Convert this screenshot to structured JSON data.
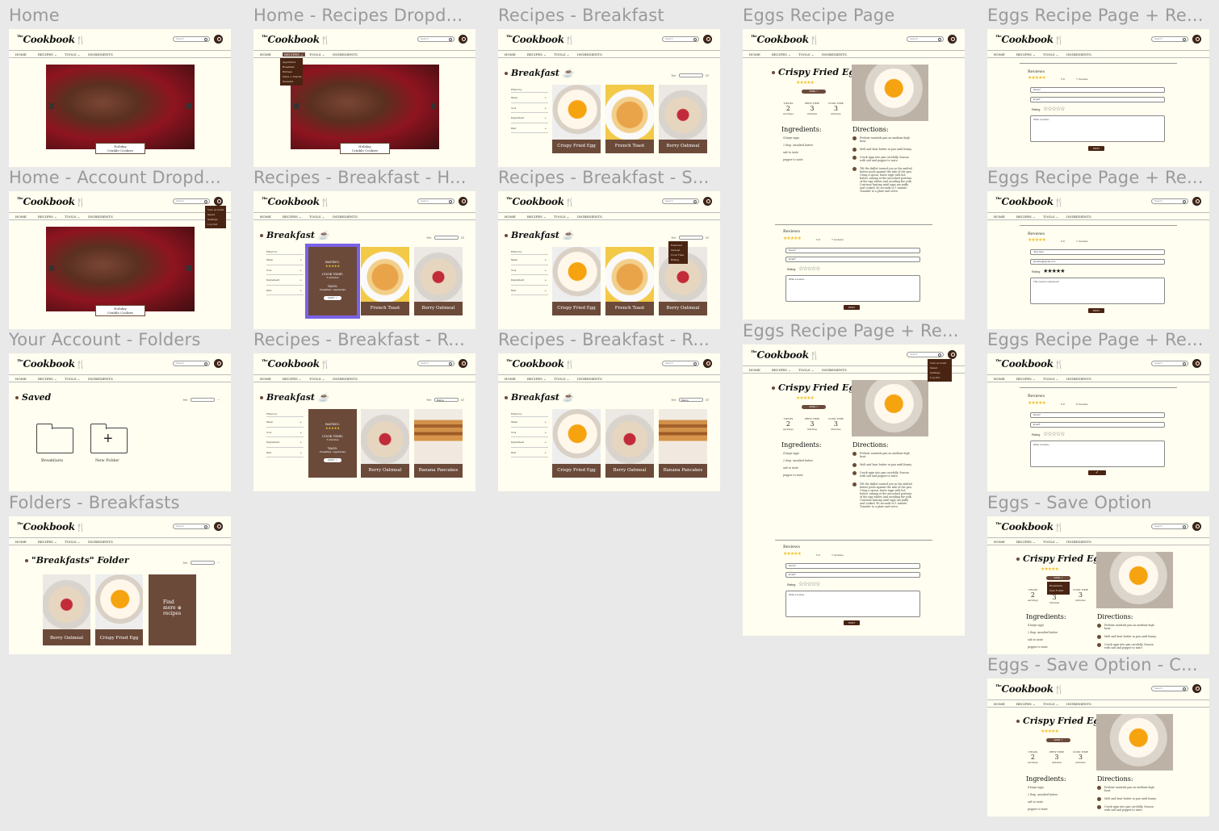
{
  "app": {
    "logo_the": "The",
    "logo_name": "Cookbook",
    "search_placeholder": "Search",
    "nav": {
      "home": "HOME",
      "recipes": "RECIPES ⌄",
      "tools": "TOOLS ⌄",
      "ingredients": "INGREDIENTS"
    }
  },
  "frames": {
    "home": "Home",
    "home_recipes": "Home - Recipes Dropd...",
    "breakfast": "Recipes - Breakfast",
    "eggs": "Eggs Recipe Page",
    "eggs_re1": "Eggs Recipe Page + Re...",
    "home_account": "Home - Account Dropd...",
    "breakfast_h": "Recipes - Breakfast - H...",
    "breakfast_s": "Recipes - Breakfast - S...",
    "eggs_re2": "Eggs Recipe Page + Re...",
    "folders": "Your Account - Folders",
    "breakfast_r1": "Recipes - Breakfast - R...",
    "breakfast_r2": "Recipes - Breakfast - R...",
    "eggs_re3": "Eggs Recipe Page + Re...",
    "eggs_re4": "Eggs Recipe Page + Re...",
    "folders_breakfasts": "Folders - Breakfasts",
    "eggs_save": "Eggs - Save Option",
    "eggs_save_c": "Eggs - Save Option - C..."
  },
  "hero": {
    "caption": "Holiday\nCrinkle Cookies"
  },
  "recipes_dropdown": [
    "Appetizers",
    "Breakfast",
    "Entrees",
    "Sides + Snacks",
    "Desserts"
  ],
  "account_dropdown": [
    "Your Account",
    "Saved",
    "Settings",
    "Log Out"
  ],
  "sort_dropdown": [
    "Featured",
    "Newest",
    "Cook Time",
    "Rating"
  ],
  "breakfast": {
    "title": "Breakfast ☕",
    "sort_label": "Sort:",
    "sort_rating": "Rating",
    "page": "1/2",
    "filters": [
      "Filter by:",
      "Meal",
      "Tool",
      "Ingredient",
      "Diet"
    ],
    "cards": {
      "eggs": "Crispy Fried Egg",
      "toast": "French Toast",
      "oatmeal": "Berry Oatmeal",
      "pancakes": "Banana Pancakes"
    },
    "hover": {
      "rating": "RATING:",
      "stars": "★★★★★",
      "cook_time": "COOK TIME:",
      "cook_val": "5 minutes",
      "tags": "TAGS:",
      "tags_val": "breakfast, vegetarian",
      "save": "SAVE ☆"
    }
  },
  "recipe": {
    "title": "Crispy Fried Eggs",
    "stars": "★★★★★",
    "save": "SAVE ☆",
    "yields": "YIELDS",
    "yields_v": "2",
    "yields_u": "servings",
    "prep": "PREP TIME",
    "prep_v": "3",
    "prep_u": "minutes",
    "cook": "COOK TIME",
    "cook_v": "3",
    "cook_u": "minutes",
    "ingredients_h": "Ingredients:",
    "ingredients": [
      "4 large eggs",
      "2 tbsp. unsalted butter",
      "salt to taste",
      "pepper to taste"
    ],
    "directions_h": "Directions:",
    "directions": [
      "Preheat nonstick pan on medium-high heat.",
      "Melt and heat butter in pan until foamy.",
      "Crack eggs into pan carefully. Season with salt and pepper to taste.",
      "Tilt the skillet toward you so the melted butter pools against the side of the pan. Using a spoon, baste eggs with hot butter, aiming at the uncooked portions of the egg whites and avoiding the yolk. Continue basting until eggs are puffy and cooked, 45 seconds to 1 minute. Transfer to a plate and serve."
    ],
    "save_menu": [
      "Breakfasts",
      "New Folder"
    ]
  },
  "reviews": {
    "title": "Reviews",
    "stars": "★★★★★",
    "score": "5.0",
    "count": "7 reviews",
    "count8": "8 reviews",
    "name": "Name*",
    "email": "Email*",
    "rating": "Rating:",
    "empty_stars": "☆☆☆☆☆",
    "full_stars": "★★★★★",
    "write": "Write a review...",
    "post": "POST",
    "check": "✓",
    "name_v": "Jane Doe",
    "email_v": "janedoe@gmail.com",
    "review_v": "This recipe is awesome!"
  },
  "account": {
    "saved": "Saved",
    "sort_label": "Sort:",
    "breakfasts": "Breakfasts",
    "new_folder": "New Folder"
  },
  "folder": {
    "title": "\"Breakfasts\" Folder",
    "sort_label": "Sort:",
    "find": "Find\nmore ⊕\nrecipes"
  }
}
